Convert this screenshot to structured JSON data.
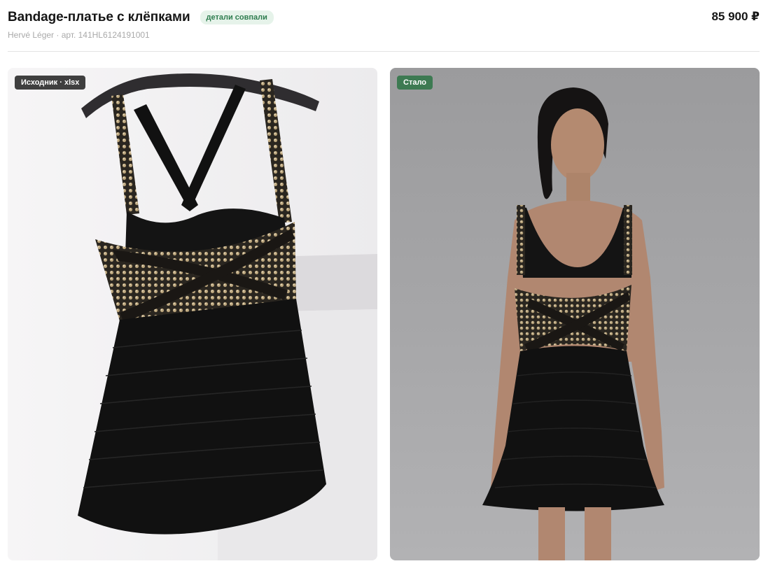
{
  "product": {
    "title": "Bandage-платье с клёпками",
    "match_badge": "детали совпали",
    "brand_sku": "Hervé Léger · арт. 141HL6124191001",
    "price": "85 900 ₽"
  },
  "panels": {
    "source_label": "Исходник · xlsx",
    "result_label": "Стало"
  },
  "colors": {
    "badge_bg": "#e6f3ea",
    "badge_text": "#2e7d4f",
    "result_tag": "#3d7a52",
    "source_tag": "#262626"
  }
}
